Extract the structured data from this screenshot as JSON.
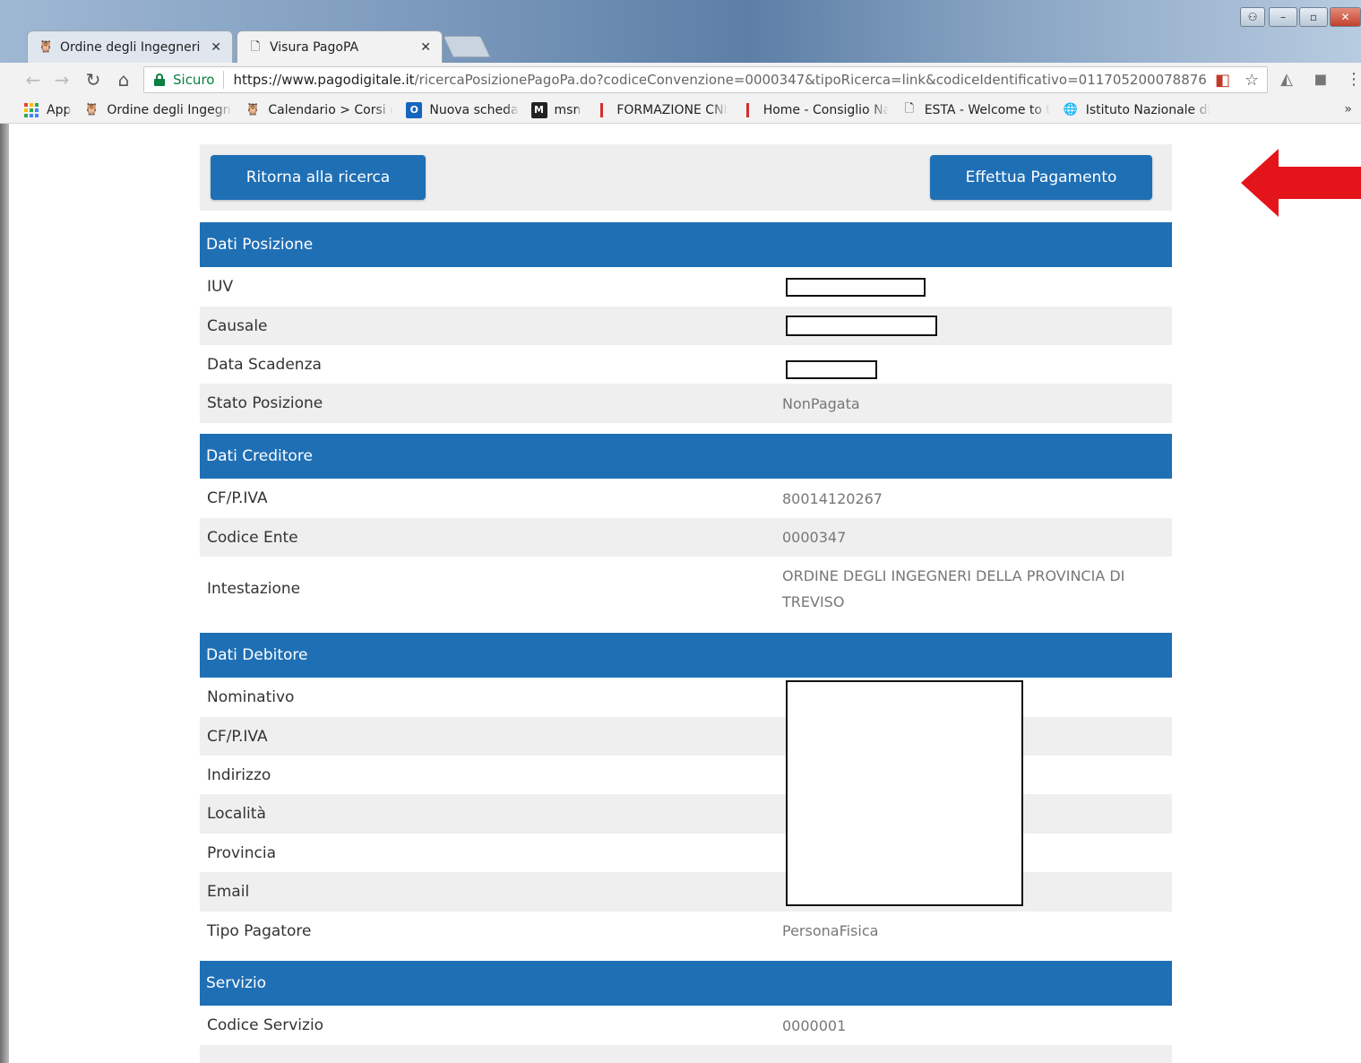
{
  "browser": {
    "tabs": [
      {
        "label": "Ordine degli Ingegneri d",
        "icon": "owl-favicon-icon"
      },
      {
        "label": "Visura PagoPA",
        "icon": "page-icon"
      }
    ],
    "omnibox": {
      "secure_label": "Sicuro",
      "url_host": "https://www.pagodigitale.it",
      "url_path": "/ricercaPosizionePagoPa.do?codiceConvenzione=0000347&tipoRicerca=link&codiceIdentificativo=011705200078876"
    },
    "bookmarks": [
      {
        "label": "App",
        "icon": "apps-grid-icon"
      },
      {
        "label": "Ordine degli Ingegne",
        "icon": "owl-favicon-icon"
      },
      {
        "label": "Calendario > Corsi di",
        "icon": "owl-favicon-icon"
      },
      {
        "label": "Nuova scheda",
        "icon": "outlook-icon"
      },
      {
        "label": "msn",
        "icon": "msn-icon"
      },
      {
        "label": "FORMAZIONE CNI",
        "icon": "cni-icon"
      },
      {
        "label": "Home - Consiglio Na",
        "icon": "cni-icon"
      },
      {
        "label": "ESTA - Welcome to t",
        "icon": "page-icon"
      },
      {
        "label": "Istituto Nazionale di",
        "icon": "globe-icon"
      }
    ],
    "more_label": "»"
  },
  "buttons": {
    "back_label": "Ritorna alla ricerca",
    "pay_label": "Effettua Pagamento"
  },
  "sections": {
    "posizione": {
      "title": "Dati Posizione",
      "rows": [
        {
          "label": "IUV",
          "value": ""
        },
        {
          "label": "Causale",
          "value": ""
        },
        {
          "label": "Data Scadenza",
          "value": ""
        },
        {
          "label": "Stato Posizione",
          "value": "NonPagata"
        }
      ]
    },
    "creditore": {
      "title": "Dati Creditore",
      "rows": [
        {
          "label": "CF/P.IVA",
          "value": "80014120267"
        },
        {
          "label": "Codice Ente",
          "value": "0000347"
        },
        {
          "label": "Intestazione",
          "value": "ORDINE DEGLI INGEGNERI DELLA PROVINCIA DI TREVISO"
        }
      ]
    },
    "debitore": {
      "title": "Dati Debitore",
      "rows": [
        {
          "label": "Nominativo",
          "value": ""
        },
        {
          "label": "CF/P.IVA",
          "value": ""
        },
        {
          "label": "Indirizzo",
          "value": ""
        },
        {
          "label": "Località",
          "value": ""
        },
        {
          "label": "Provincia",
          "value": ""
        },
        {
          "label": "Email",
          "value": ""
        },
        {
          "label": "Tipo Pagatore",
          "value": "PersonaFisica"
        }
      ]
    },
    "servizio": {
      "title": "Servizio",
      "rows": [
        {
          "label": "Codice Servizio",
          "value": "0000001"
        }
      ]
    }
  },
  "colors": {
    "header_blue": "#1f6fb5",
    "arrow_red": "#e4141b",
    "secure_green": "#0b8043"
  }
}
